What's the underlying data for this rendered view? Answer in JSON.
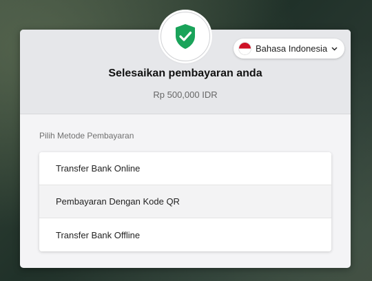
{
  "header": {
    "title": "Selesaikan pembayaran anda",
    "amount": "Rp 500,000 IDR",
    "badge_icon": "shield-check-icon",
    "badge_color": "#1aa35a"
  },
  "language": {
    "label": "Bahasa Indonesia",
    "flag_icon": "indonesia-flag-icon",
    "chevron_icon": "chevron-down-icon"
  },
  "payment": {
    "section_label": "Pilih Metode Pembayaran",
    "methods": [
      {
        "label": "Transfer Bank Online"
      },
      {
        "label": "Pembayaran Dengan Kode QR"
      },
      {
        "label": "Transfer Bank Offline"
      }
    ]
  }
}
